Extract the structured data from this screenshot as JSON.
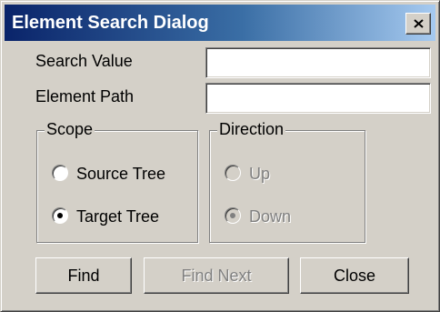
{
  "window": {
    "title": "Element Search Dialog",
    "close_icon": "close-x-icon"
  },
  "fields": {
    "search_value": {
      "label": "Search Value",
      "value": ""
    },
    "element_path": {
      "label": "Element Path",
      "value": ""
    }
  },
  "scope": {
    "legend": "Scope",
    "options": [
      {
        "label": "Source Tree",
        "selected": false,
        "enabled": true
      },
      {
        "label": "Target Tree",
        "selected": true,
        "enabled": true
      }
    ]
  },
  "direction": {
    "legend": "Direction",
    "options": [
      {
        "label": "Up",
        "selected": false,
        "enabled": false
      },
      {
        "label": "Down",
        "selected": true,
        "enabled": false
      }
    ]
  },
  "buttons": {
    "find": {
      "label": "Find",
      "enabled": true
    },
    "find_next": {
      "label": "Find Next",
      "enabled": false
    },
    "close": {
      "label": "Close",
      "enabled": true
    }
  },
  "colors": {
    "title_gradient_start": "#0a246a",
    "title_gradient_end": "#a6caf0",
    "face": "#d4d0c8",
    "disabled_text": "#808080"
  }
}
